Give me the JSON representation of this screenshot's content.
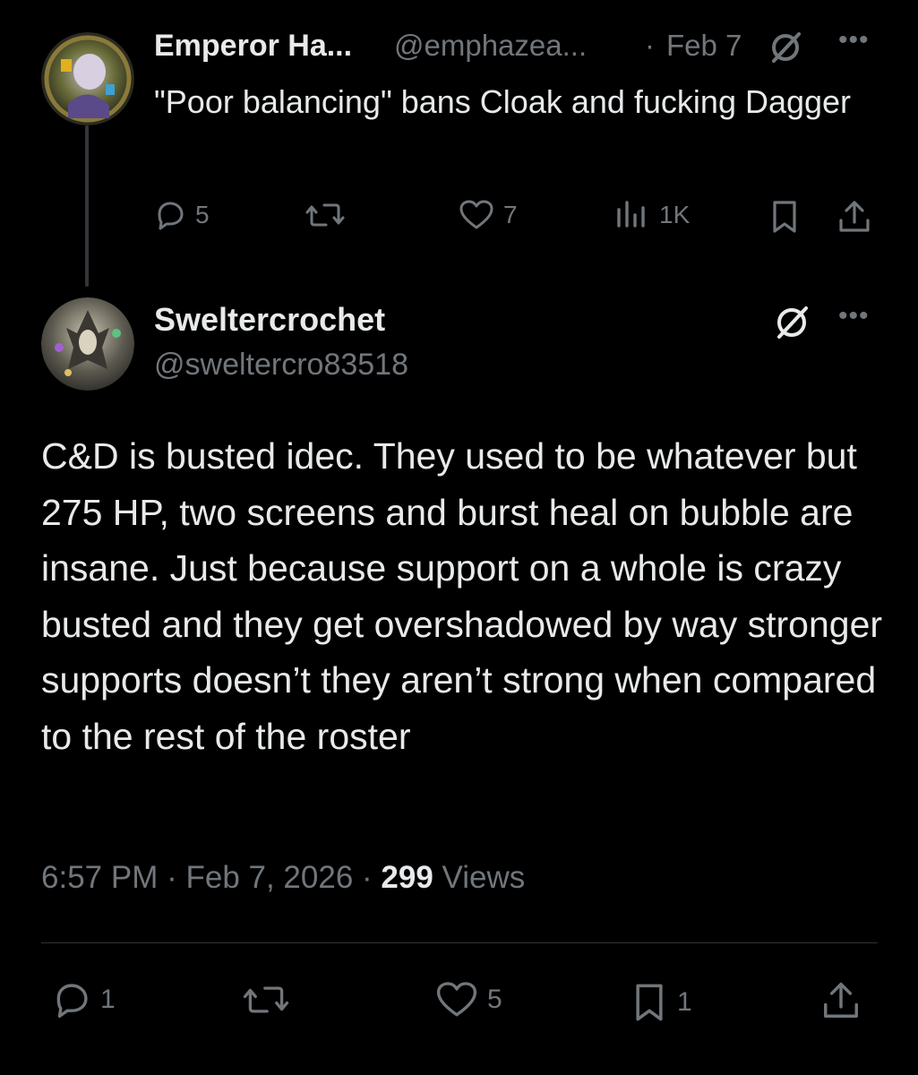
{
  "parent_tweet": {
    "author_name": "Emperor Ha...",
    "handle": "@emphazea...",
    "separator": "·",
    "date": "Feb 7",
    "more": "•••",
    "text": "\"Poor balancing\" bans Cloak and fucking Dagger",
    "replies": "5",
    "retweets": "",
    "likes": "7",
    "views": "1K"
  },
  "main_tweet": {
    "author_name": "Sweltercrochet",
    "handle": "@sweltercro83518",
    "more": "•••",
    "text": "C&D is busted idec. They used to be whatever but 275 HP, two screens and burst heal on bubble are insane. Just because support on a whole is crazy busted and they get overshadowed by way stronger supports doesn’t they aren’t strong when compared to the rest of the roster",
    "time": "6:57 PM",
    "sep1": " · ",
    "date": "Feb 7, 2026",
    "sep2": " · ",
    "views_count": "299",
    "views_label": " Views",
    "replies": "1",
    "retweets": "",
    "likes": "5",
    "bookmarks": "1"
  },
  "icons": {
    "reply": "reply-icon",
    "retweet": "retweet-icon",
    "like": "heart-icon",
    "views": "views-icon",
    "bookmark": "bookmark-icon",
    "share": "share-icon",
    "grok": "grok-slash-icon",
    "more": "more-icon"
  },
  "colors": {
    "background": "#000000",
    "text": "#e7e9ea",
    "muted": "#71767b",
    "divider": "#2f3336"
  }
}
